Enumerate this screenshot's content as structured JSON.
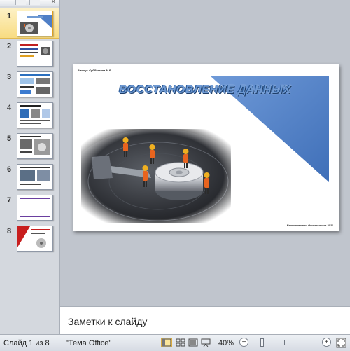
{
  "sidebar": {
    "close_glyph": "×",
    "slides": [
      {
        "number": "1",
        "selected": true
      },
      {
        "number": "2",
        "selected": false
      },
      {
        "number": "3",
        "selected": false
      },
      {
        "number": "4",
        "selected": false
      },
      {
        "number": "5",
        "selected": false
      },
      {
        "number": "6",
        "selected": false
      },
      {
        "number": "7",
        "selected": false
      },
      {
        "number": "8",
        "selected": false
      }
    ]
  },
  "slide": {
    "author": "Автор: Субботина М.В.",
    "title": "ВОССТАНОВЛЕНИЕ ДАННЫХ",
    "footer": "Выполнятели Отключения 2011",
    "accent_color": "#4f7fc6"
  },
  "notes": {
    "placeholder": "Заметки к слайду"
  },
  "statusbar": {
    "slide_info": "Слайд 1 из 8",
    "theme": "\"Тема Office\"",
    "zoom": "40%",
    "zoom_level_fraction": 0.4,
    "zoom_minus": "−",
    "zoom_plus": "+"
  }
}
